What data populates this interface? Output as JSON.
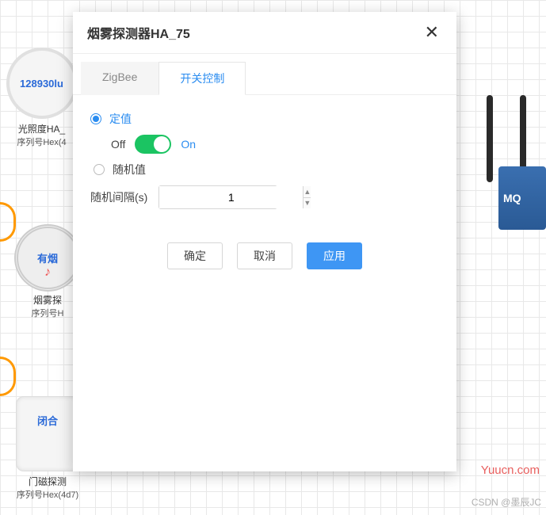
{
  "background": {
    "device1": {
      "value": "128930lu",
      "label": "光照度HA_",
      "sub": "序列号Hex(4"
    },
    "device2": {
      "status": "有烟",
      "label": "烟雾探",
      "sub": "序列号H"
    },
    "device3": {
      "status": "闭合",
      "label": "门磁探测",
      "sub": "序列号Hex(4d7)"
    },
    "gateway": {
      "label": "MQ"
    }
  },
  "modal": {
    "title": "烟雾探测器HA_75",
    "tabs": {
      "zigbee": "ZigBee",
      "switch": "开关控制"
    },
    "form": {
      "fixed_label": "定值",
      "off_label": "Off",
      "on_label": "On",
      "random_label": "随机值",
      "interval_label": "随机间隔(s)",
      "interval_value": "1"
    },
    "buttons": {
      "ok": "确定",
      "cancel": "取消",
      "apply": "应用"
    }
  },
  "watermarks": {
    "w1": "Yuucn.com",
    "w2": "CSDN @墨辰JC"
  }
}
